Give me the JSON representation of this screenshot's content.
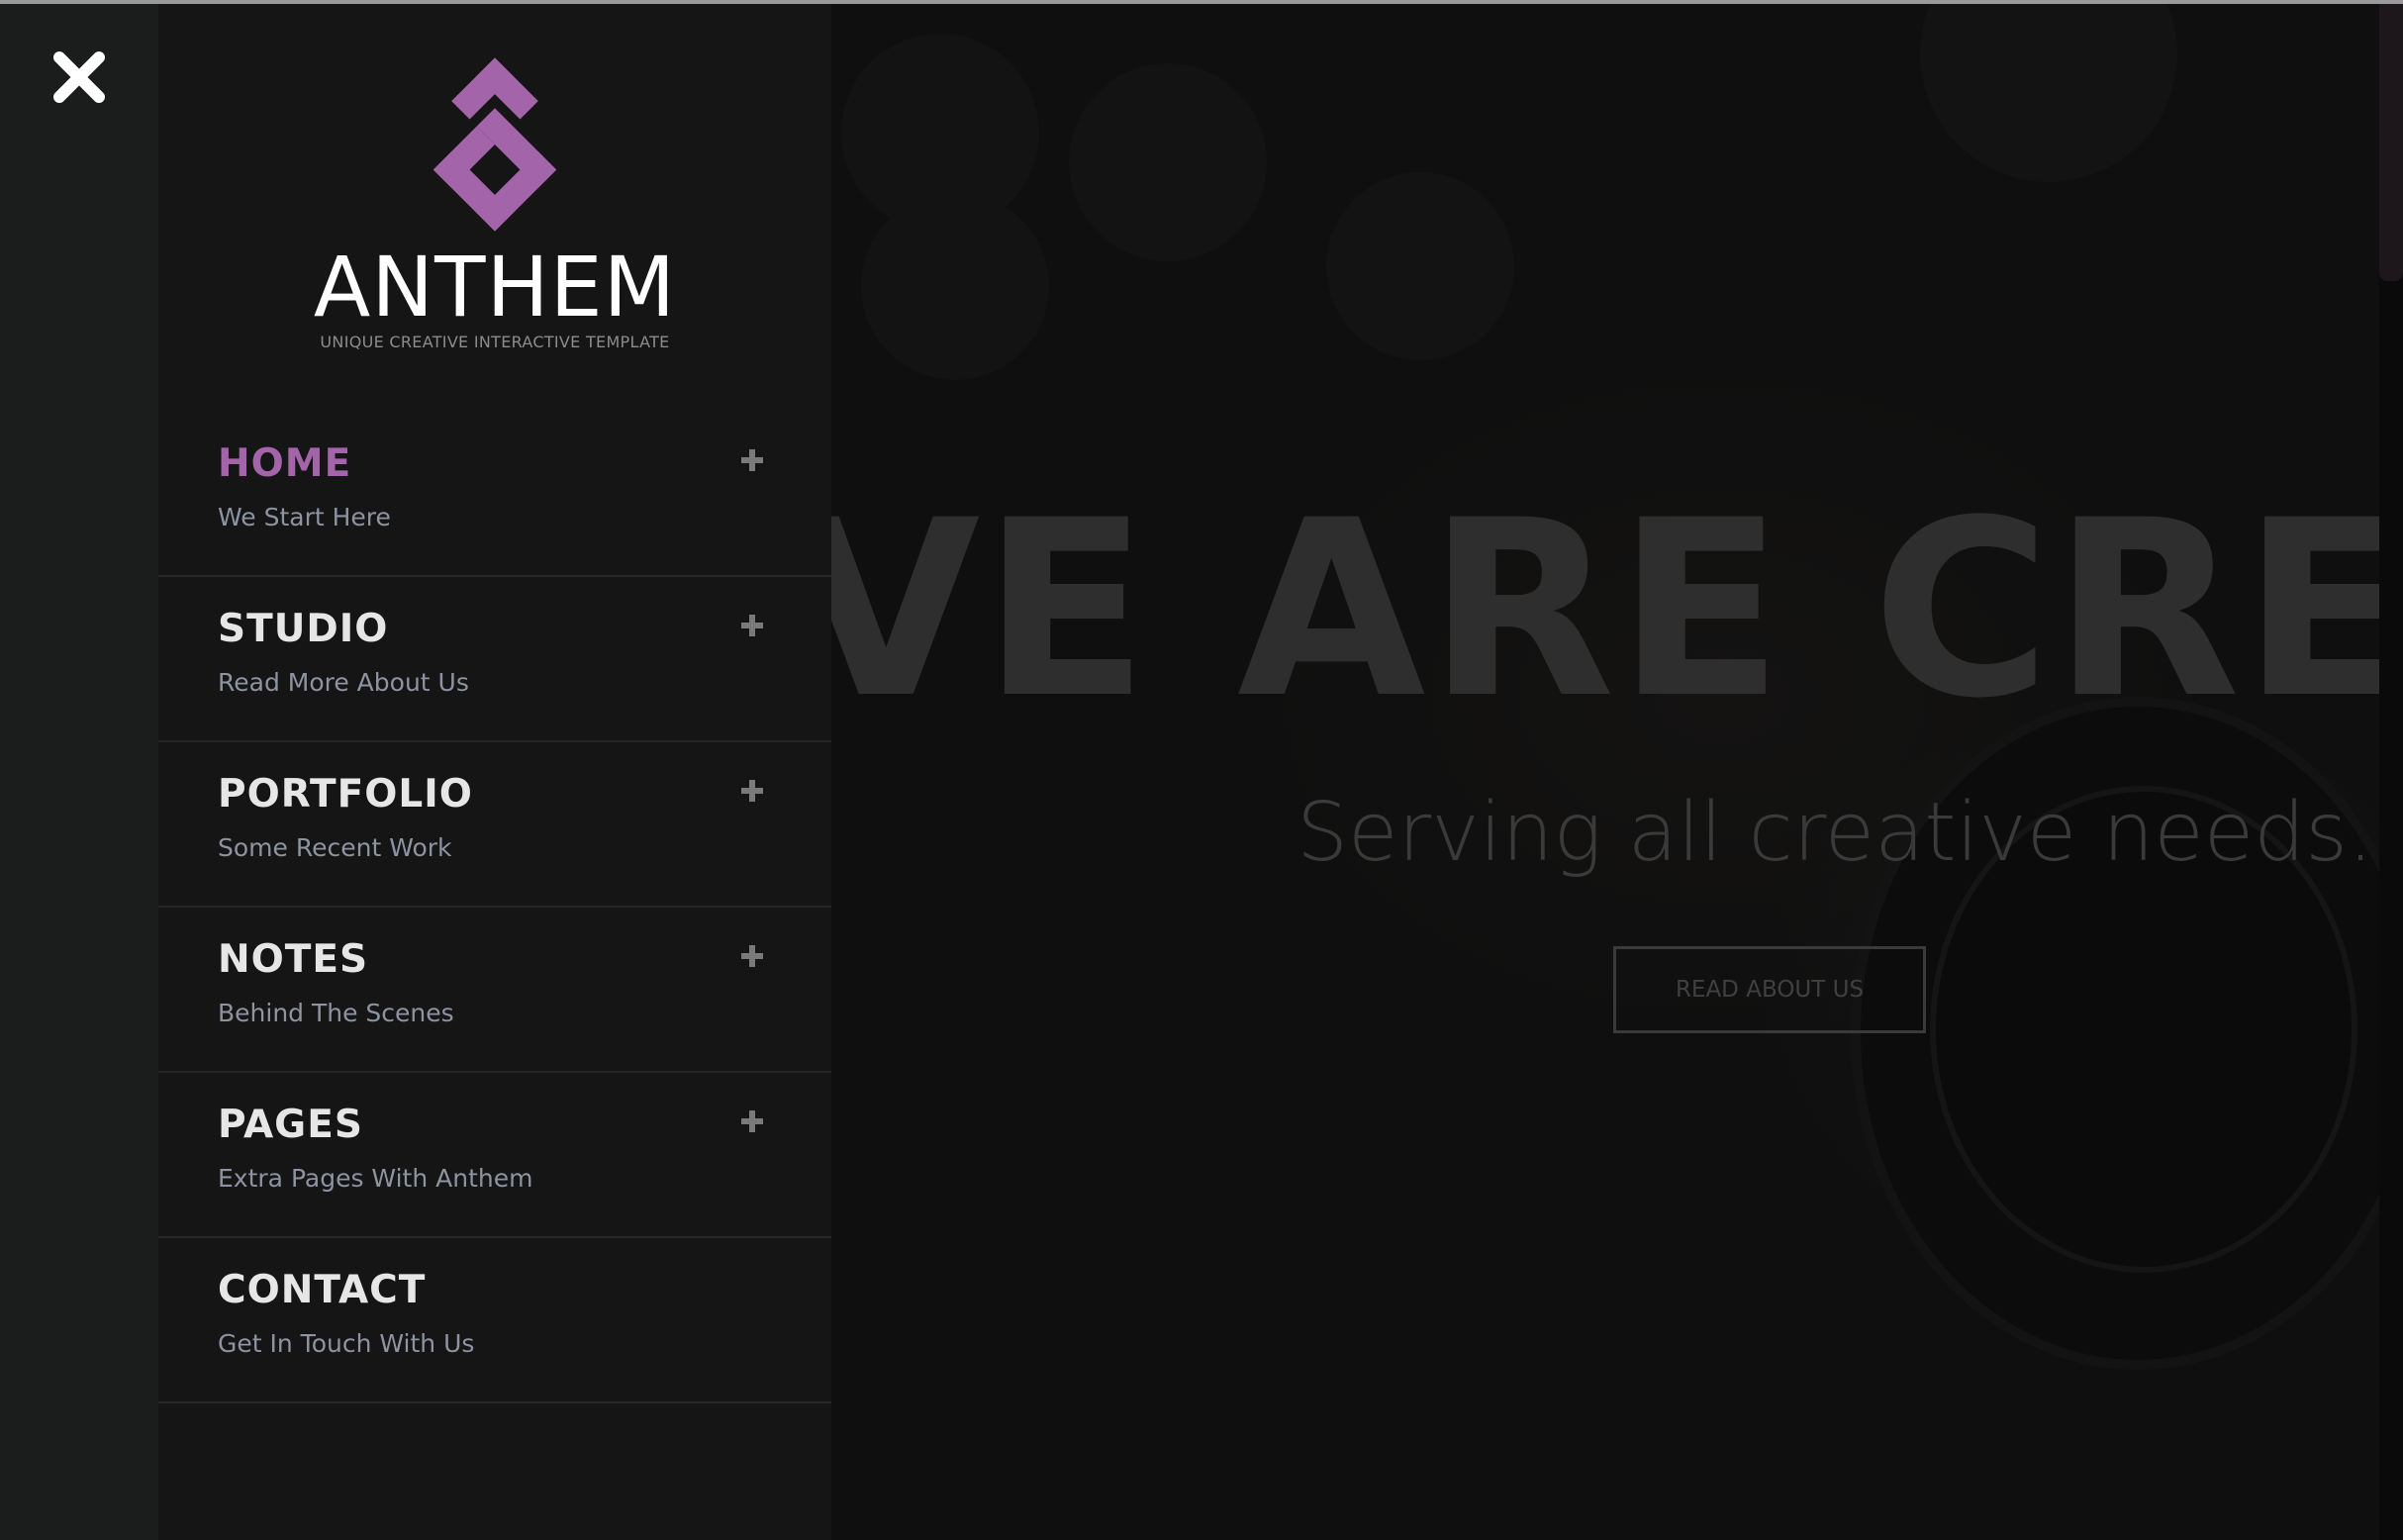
{
  "brand": {
    "name": "ANTHEM",
    "tagline": "UNIQUE CREATIVE INTERACTIVE TEMPLATE",
    "accent_color": "#a464a9"
  },
  "close_icon": "close-icon",
  "nav": {
    "items": [
      {
        "label": "HOME",
        "sub": "We Start Here",
        "active": true,
        "expand_icon": "plus-icon"
      },
      {
        "label": "STUDIO",
        "sub": "Read More About Us",
        "active": false,
        "expand_icon": "plus-icon"
      },
      {
        "label": "PORTFOLIO",
        "sub": "Some Recent Work",
        "active": false,
        "expand_icon": "plus-icon"
      },
      {
        "label": "NOTES",
        "sub": "Behind The Scenes",
        "active": false,
        "expand_icon": "plus-icon"
      },
      {
        "label": "PAGES",
        "sub": "Extra Pages With Anthem",
        "active": false,
        "expand_icon": "plus-icon"
      },
      {
        "label": "CONTACT",
        "sub": "Get In Touch With Us",
        "active": false
      }
    ]
  },
  "hero": {
    "headline": "VE ARE CREAT",
    "subheadline": "Serving all creative needs.",
    "button_label": "READ ABOUT US"
  }
}
